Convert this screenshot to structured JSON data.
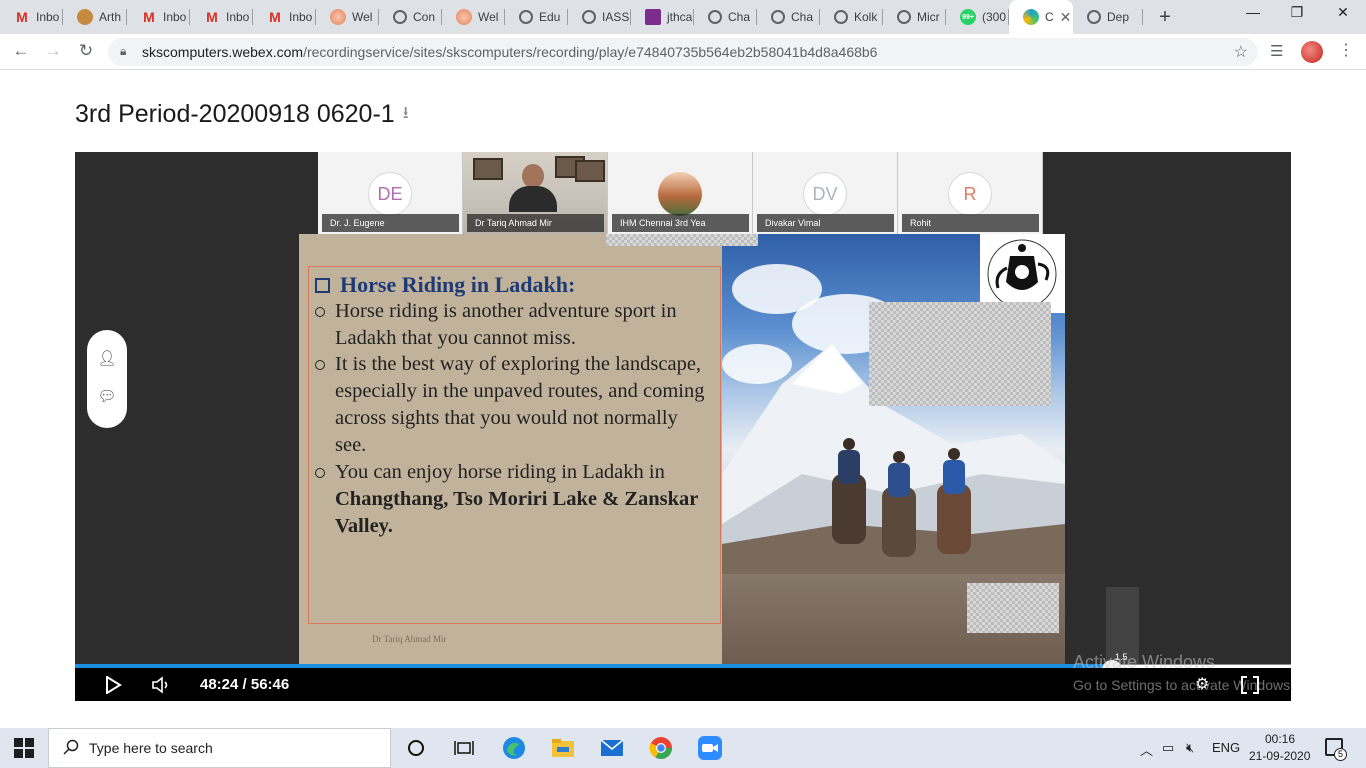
{
  "browser": {
    "tabs": [
      {
        "label": "Inbo",
        "icon": "gmail-icon",
        "color": "#d93025"
      },
      {
        "label": "Arth",
        "icon": "avatar-icon",
        "color": "#c58a3d"
      },
      {
        "label": "Inbo",
        "icon": "gmail-icon",
        "color": "#d93025"
      },
      {
        "label": "Inbo",
        "icon": "gmail-icon",
        "color": "#d93025"
      },
      {
        "label": "Inbo",
        "icon": "gmail-icon",
        "color": "#d93025"
      },
      {
        "label": "Wel",
        "icon": "webex-flower-icon",
        "color": "#e8805c"
      },
      {
        "label": "Con",
        "icon": "globe-icon",
        "color": "#5f6368"
      },
      {
        "label": "Wel",
        "icon": "webex-flower-icon",
        "color": "#e8805c"
      },
      {
        "label": "Edu",
        "icon": "globe-icon",
        "color": "#5f6368"
      },
      {
        "label": "IASS",
        "icon": "globe-icon",
        "color": "#5f6368"
      },
      {
        "label": "jthca",
        "icon": "purple-square-icon",
        "color": "#7b2d8e"
      },
      {
        "label": "Cha",
        "icon": "globe-icon",
        "color": "#5f6368"
      },
      {
        "label": "Cha",
        "icon": "globe-icon",
        "color": "#5f6368"
      },
      {
        "label": "Kolk",
        "icon": "globe-icon",
        "color": "#5f6368"
      },
      {
        "label": "Micr",
        "icon": "globe-icon",
        "color": "#5f6368"
      },
      {
        "label": "(300",
        "icon": "whatsapp-icon",
        "color": "#25d366",
        "badge": "99+"
      },
      {
        "label": "C",
        "icon": "webex-ball-icon",
        "color": "#1ea0d0",
        "active": true
      },
      {
        "label": "Dep",
        "icon": "globe-icon",
        "color": "#5f6368"
      }
    ],
    "new_tab": "+",
    "window_controls": {
      "minimize": "—",
      "maximize": "❐",
      "close": "✕"
    },
    "url_host": "skscomputers.webex.com",
    "url_path": "/recordingservice/sites/skscomputers/recording/play/e74840735b564eb2b58041b4d8a468b6"
  },
  "page": {
    "title": "3rd Period-20200918 0620-1"
  },
  "meeting": {
    "participants": [
      {
        "initials": "DE",
        "name": "Dr. J. Eugene",
        "color": "#b06fb0",
        "type": "initials"
      },
      {
        "initials": "",
        "name": "Dr Tariq Ahmad Mir",
        "color": "",
        "type": "video"
      },
      {
        "initials": "",
        "name": "IHM Chennai 3rd Yea",
        "color": "",
        "type": "photo"
      },
      {
        "initials": "DV",
        "name": "Divakar Vimal",
        "color": "#aab4bf",
        "type": "initials"
      },
      {
        "initials": "R",
        "name": "Rohit",
        "color": "#e07a5f",
        "type": "initials"
      }
    ]
  },
  "slide": {
    "title": "Horse Riding in Ladakh:",
    "bullets": [
      {
        "text": "Horse riding is another adventure sport in Ladakh that you cannot miss.",
        "bold": ""
      },
      {
        "text": "It is the best way of exploring the landscape, especially in the unpaved routes, and coming across sights that you would not normally see.",
        "bold": ""
      },
      {
        "text": "You can enjoy horse riding in Ladakh in ",
        "bold": "Changthang, Tso Moriri Lake & Zanskar Valley."
      }
    ],
    "footer": "Dr Tariq Ahmad Mir",
    "title_color": "#1f3b75",
    "background_color": "#c1b39b"
  },
  "player": {
    "time": "48:24 / 56:46",
    "progress": 0.853,
    "speed_label": "1.5",
    "accent": "#1a8fe0"
  },
  "watermark": {
    "line1": "Activate Windows",
    "line2": "Go to Settings to activate Windows."
  },
  "taskbar": {
    "search_placeholder": "Type here to search",
    "language": "ENG",
    "time": "00:16",
    "date": "21-09-2020",
    "notifications": "5",
    "apps": [
      "task-view-icon",
      "timeline-icon",
      "edge-icon",
      "file-explorer-icon",
      "mail-icon",
      "chrome-icon",
      "zoom-icon"
    ]
  }
}
